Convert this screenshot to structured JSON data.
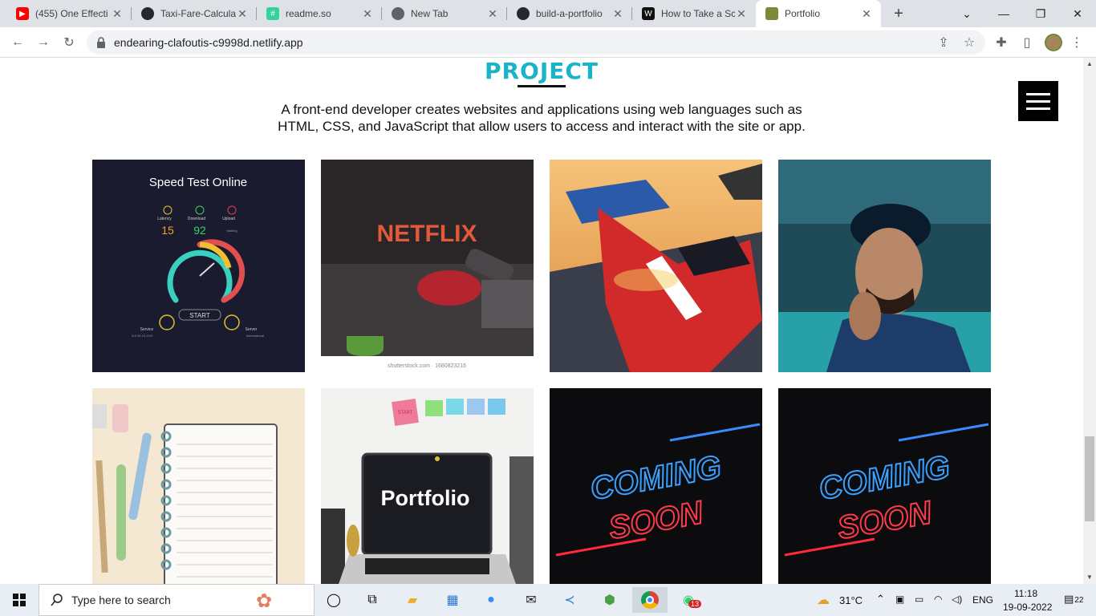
{
  "browser": {
    "tabs": [
      {
        "title": "(455) One Effecti",
        "favicon": "youtube-icon",
        "color": "#ff0000"
      },
      {
        "title": "Taxi-Fare-Calculat",
        "favicon": "github-icon",
        "color": "#24292f"
      },
      {
        "title": "readme.so",
        "favicon": "readme-icon",
        "color": "#35d39b"
      },
      {
        "title": "New Tab",
        "favicon": "chrome-icon",
        "color": "#5f6368"
      },
      {
        "title": "build-a-portfolio",
        "favicon": "github-icon",
        "color": "#24292f"
      },
      {
        "title": "How to Take a Sc",
        "favicon": "hashnode-icon",
        "color": "#111111"
      },
      {
        "title": "Portfolio",
        "favicon": "portfolio-icon",
        "color": "#7a8a3a",
        "active": true
      }
    ],
    "url": "endearing-clafoutis-c9998d.netlify.app"
  },
  "page": {
    "title": "PROJECT",
    "description_line1": "A front-end developer creates websites and applications using web languages such as",
    "description_line2": "HTML, CSS, and JavaScript that allow users to access and interact with the site or app."
  },
  "projects": {
    "speed": {
      "title": "Speed Test Online",
      "latency": "Latency",
      "download": "Download",
      "upload": "Upload",
      "latency_val": "15",
      "download_val": "92",
      "upload_val": "Waiting",
      "start": "START",
      "service": "Service",
      "server": "Server",
      "service_sub": "110.94.15.XXX",
      "server_sub": "International"
    },
    "netflix": {
      "logo": "NETFLIX",
      "credit": "shutterstock.com · 1680823216"
    },
    "portfolio": {
      "laptop_text": "Portfolio",
      "sticky": "START"
    },
    "coming1": {
      "line1": "COMING",
      "line2": "SOON"
    },
    "coming2": {
      "line1": "COMING",
      "line2": "SOON"
    }
  },
  "taskbar": {
    "search_placeholder": "Type here to search",
    "weather": "31°C",
    "language": "ENG",
    "time": "11:18",
    "date": "19-09-2022",
    "notification_count": "22",
    "whatsapp_badge": "13"
  }
}
